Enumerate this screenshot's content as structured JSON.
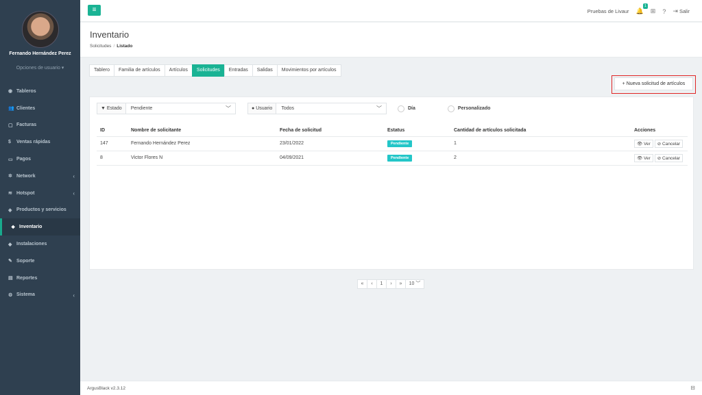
{
  "user": {
    "name": "Fernando Hernández Perez",
    "options": "Opciones de usuario ▾"
  },
  "sidebar": {
    "items": [
      {
        "label": "Tableros",
        "icon": "dashboard-icon",
        "glyph": "◉"
      },
      {
        "label": "Clientes",
        "icon": "users-icon",
        "glyph": "👥"
      },
      {
        "label": "Facturas",
        "icon": "file-icon",
        "glyph": "▢"
      },
      {
        "label": "Ventas rápidas",
        "icon": "dollar-icon",
        "glyph": "$"
      },
      {
        "label": "Pagos",
        "icon": "money-icon",
        "glyph": "▭"
      },
      {
        "label": "Network",
        "icon": "network-icon",
        "glyph": "✲",
        "chev": "‹"
      },
      {
        "label": "Hotspot",
        "icon": "wifi-icon",
        "glyph": "≋",
        "chev": "‹"
      },
      {
        "label": "Productos y servicios",
        "icon": "tag-icon",
        "glyph": "◈"
      },
      {
        "label": "Inventario",
        "icon": "cubes-icon",
        "glyph": "❖"
      },
      {
        "label": "Instalaciones",
        "icon": "tools-icon",
        "glyph": "◆"
      },
      {
        "label": "Soporte",
        "icon": "wrench-icon",
        "glyph": "✎"
      },
      {
        "label": "Reportes",
        "icon": "book-icon",
        "glyph": "▤"
      },
      {
        "label": "Sistema",
        "icon": "cogs-icon",
        "glyph": "⚙",
        "chev": "‹"
      }
    ]
  },
  "topbar": {
    "menu_glyph": "≡",
    "account": "Pruebas de Livaur",
    "notif_count": "1",
    "logout": "Salir",
    "bell_glyph": "🔔",
    "network_glyph": "⊞",
    "help_glyph": "?",
    "logout_glyph": "⇥"
  },
  "page": {
    "title": "Inventario",
    "crumb_root": "Solicitudes",
    "crumb_current": "Listado",
    "crumb_sep": "/"
  },
  "tabs": [
    "Tablero",
    "Familia de artículos",
    "Artículos",
    "Solicitudes",
    "Entradas",
    "Salidas",
    "Movimientos por artículos"
  ],
  "new_request": "+ Nueva solicitud de artículos",
  "filters": {
    "estado_label": "Estado",
    "estado_value": "Pendiente",
    "usuario_label": "Usuario",
    "usuario_value": "Todos",
    "radio_day": "Día",
    "radio_custom": "Personalizado",
    "dropdown_glyph": "﹀"
  },
  "table": {
    "headers": [
      "ID",
      "Nombre de solicitante",
      "Fecha de solicitud",
      "Estatus",
      "Cantidad de artículos solicitada",
      "Acciones"
    ],
    "rows": [
      {
        "id": "147",
        "name": "Fernando Hernández Perez",
        "date": "23/01/2022",
        "status": "Pendiente",
        "qty": "1"
      },
      {
        "id": "8",
        "name": "Victor Flores N",
        "date": "04/09/2021",
        "status": "Pendiente",
        "qty": "2"
      }
    ],
    "view_label": "👁 Ver",
    "cancel_label": "⊘ Cancelar"
  },
  "pager": {
    "first": "«",
    "prev": "‹",
    "page": "1",
    "next": "›",
    "last": "»",
    "size": "10 ﹀"
  },
  "footer": {
    "version": "ArgusBlack v2.3.12",
    "icon_glyph": "⊟"
  },
  "colors": {
    "accent": "#1ab394",
    "sidebar": "#2f4050",
    "status": "#23c6c8",
    "highlight": "#e02424"
  }
}
